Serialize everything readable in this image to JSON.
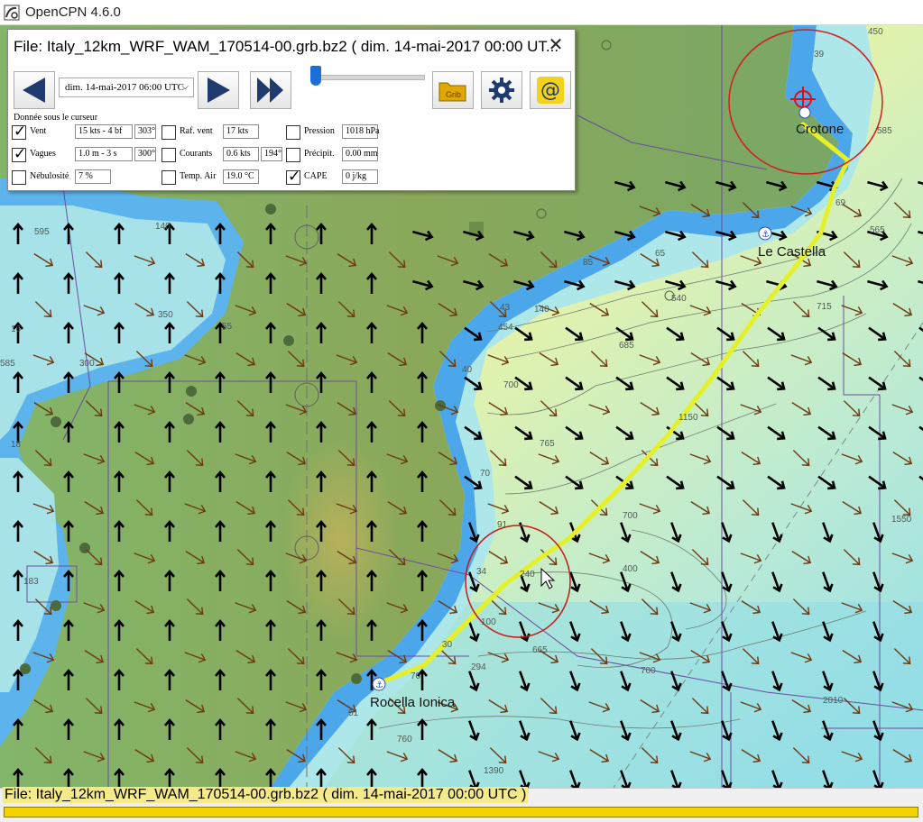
{
  "app": {
    "title": "OpenCPN 4.6.0"
  },
  "grib_dialog": {
    "title": "File: Italy_12km_WRF_WAM_170514-00.grb.bz2 ( dim. 14-mai-2017 00:00  UT...",
    "close_icon": "close-icon",
    "time_value": "dim. 14-mai-2017 06:00  UTC",
    "slider_fraction": 0.0,
    "header": "Donnée sous le curseur",
    "rows": [
      {
        "name": "vent",
        "label": "Vent",
        "checked": true,
        "value": "15 kts - 4 bf",
        "value2": "303°"
      },
      {
        "name": "vagues",
        "label": "Vagues",
        "checked": true,
        "value": "1.0 m - 3 s",
        "value2": "300°"
      },
      {
        "name": "nebulosite",
        "label": "Nébulosité",
        "checked": false,
        "value": "7 %",
        "value2": ""
      },
      {
        "name": "raf-vent",
        "label": "Raf. vent",
        "checked": false,
        "value": "17 kts",
        "value2": ""
      },
      {
        "name": "courants",
        "label": "Courants",
        "checked": false,
        "value": "0.6 kts",
        "value2": "194°"
      },
      {
        "name": "temp-air",
        "label": "Temp. Air",
        "checked": false,
        "value": "19.0 °C",
        "value2": ""
      },
      {
        "name": "pression",
        "label": "Pression",
        "checked": false,
        "value": "1018 hPa",
        "value2": ""
      },
      {
        "name": "precipit",
        "label": "Précipit.",
        "checked": false,
        "value": "0.00 mm",
        "value2": ""
      },
      {
        "name": "cape",
        "label": "CAPE",
        "checked": true,
        "value": "0 j/kg",
        "value2": ""
      }
    ],
    "buttons": {
      "grb_label": "Grib",
      "at_label": "@"
    }
  },
  "chart": {
    "place_labels": [
      "Crotone",
      "Le Castella",
      "Rocella Ionica"
    ],
    "depth_labels": [
      "450",
      "39",
      "585",
      "69",
      "565",
      "715",
      "140",
      "595",
      "350",
      "55",
      "585",
      "300",
      "183",
      "85",
      "65",
      "540",
      "43",
      "140",
      "454",
      "685",
      "700",
      "1150",
      "765",
      "70",
      "91",
      "34",
      "240",
      "700",
      "1550",
      "400",
      "665",
      "700",
      "294",
      "760",
      "2010",
      "1390",
      "16",
      "70",
      "51",
      "18",
      "30",
      "100",
      "40"
    ]
  },
  "statusbar": {
    "text": "File: Italy_12km_WRF_WAM_170514-00.grb.bz2 ( dim. 14-mai-2017 00:00  UTC )",
    "progress": 1.0
  },
  "colors": {
    "land_green": "#7faa5e",
    "sea_light": "#aee7ea",
    "sea_blue": "#5fb6ee",
    "track_yellow": "#e3f02a",
    "wave_arrow": "#000000",
    "wind_arrow": "#6b3a12"
  }
}
